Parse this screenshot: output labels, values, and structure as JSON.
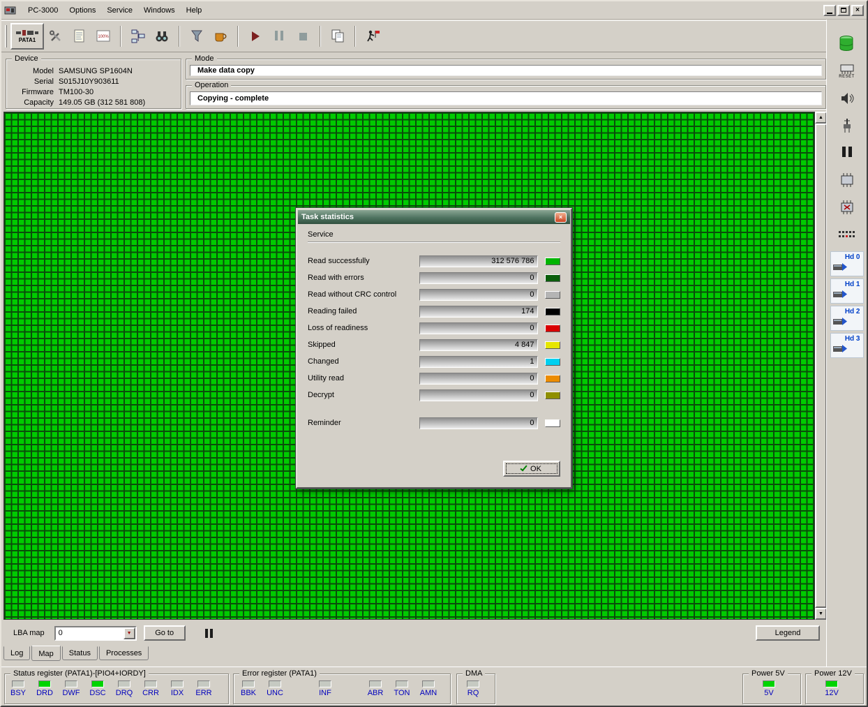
{
  "window": {
    "menu": [
      "PC-3000",
      "Options",
      "Service",
      "Windows",
      "Help"
    ]
  },
  "toolbar": {
    "pata_label": "PATA1"
  },
  "icons": {
    "close": "×",
    "scroll_up": "▲",
    "scroll_down": "▼",
    "dropdown": "▼",
    "hundred_label": "100%",
    "reset_label": "RESET"
  },
  "device_panel": {
    "title": "Device",
    "rows": [
      {
        "label": "Model",
        "value": "SAMSUNG SP1604N"
      },
      {
        "label": "Serial",
        "value": "S015J10Y903611"
      },
      {
        "label": "Firmware",
        "value": "TM100-30"
      },
      {
        "label": "Capacity",
        "value": "149.05 GB (312 581 808)"
      }
    ]
  },
  "mode_panel": {
    "title": "Mode",
    "value": "Make data copy"
  },
  "operation_panel": {
    "title": "Operation",
    "value": "Copying - complete"
  },
  "dialog": {
    "title": "Task statistics",
    "section": "Service",
    "stats": [
      {
        "label": "Read successfully",
        "value": "312 576 786",
        "color": "#00b400"
      },
      {
        "label": "Read with errors",
        "value": "0",
        "color": "#0b5e0b"
      },
      {
        "label": "Read without CRC control",
        "value": "0",
        "color": "#b4b4b4"
      },
      {
        "label": "Reading failed",
        "value": "174",
        "color": "#000000"
      },
      {
        "label": "Loss of readiness",
        "value": "0",
        "color": "#d90000"
      },
      {
        "label": "Skipped",
        "value": "4 847",
        "color": "#e6e600"
      },
      {
        "label": "Changed",
        "value": "1",
        "color": "#00d0f0"
      },
      {
        "label": "Utility read",
        "value": "0",
        "color": "#ec8c00"
      },
      {
        "label": "Decrypt",
        "value": "0",
        "color": "#8f8f00"
      },
      {
        "label": "Reminder",
        "value": "0",
        "color": "#ffffff"
      }
    ],
    "ok_label": "OK"
  },
  "map_bar": {
    "lba_label": "LBA map",
    "lba_value": "0",
    "goto_label": "Go to",
    "legend_label": "Legend"
  },
  "tabs": [
    {
      "label": "Log"
    },
    {
      "label": "Map"
    },
    {
      "label": "Status"
    },
    {
      "label": "Processes"
    }
  ],
  "status_bar": {
    "status_register": {
      "title": "Status register (PATA1)-[PIO4+IORDY]",
      "bits": [
        {
          "label": "BSY",
          "on": false
        },
        {
          "label": "DRD",
          "on": true
        },
        {
          "label": "DWF",
          "on": false
        },
        {
          "label": "DSC",
          "on": true
        },
        {
          "label": "DRQ",
          "on": false
        },
        {
          "label": "CRR",
          "on": false
        },
        {
          "label": "IDX",
          "on": false
        },
        {
          "label": "ERR",
          "on": false
        }
      ]
    },
    "error_register": {
      "title": "Error register (PATA1)",
      "bits": [
        {
          "label": "BBK",
          "on": false
        },
        {
          "label": "UNC",
          "on": false
        },
        {
          "label": "INF",
          "on": false
        },
        {
          "label": "ABR",
          "on": false
        },
        {
          "label": "TON",
          "on": false
        },
        {
          "label": "AMN",
          "on": false
        }
      ]
    },
    "dma": {
      "title": "DMA",
      "bits": [
        {
          "label": "RQ",
          "on": false
        }
      ]
    },
    "power5": {
      "title": "Power 5V",
      "label": "5V",
      "on": true
    },
    "power12": {
      "title": "Power 12V",
      "label": "12V",
      "on": true
    }
  },
  "sidebar": {
    "hd_buttons": [
      "Hd 0",
      "Hd 1",
      "Hd 2",
      "Hd 3"
    ]
  },
  "theme": {
    "led_on": "#00d400",
    "led_off": "#c6cac2",
    "map_green": "#00cb00",
    "label_blue": "#0000bd"
  }
}
